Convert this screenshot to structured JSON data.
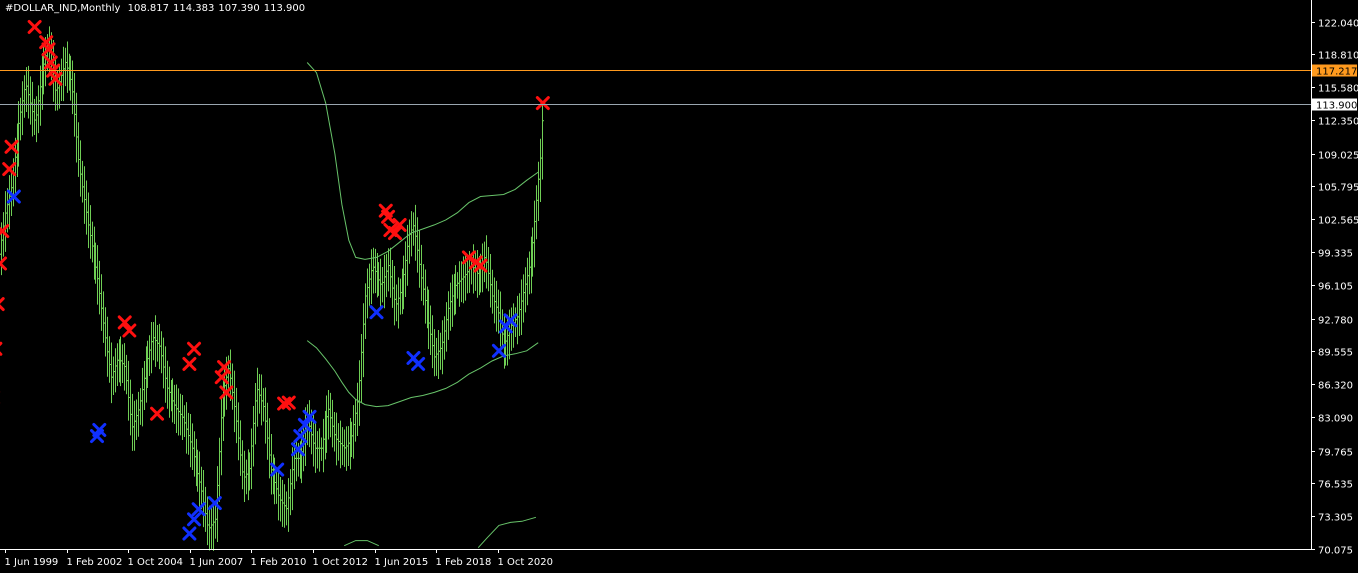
{
  "header": {
    "symbol": "#DOLLAR_IND,Monthly",
    "open": "108.817",
    "high": "114.383",
    "low": "107.390",
    "close": "113.900"
  },
  "colors": {
    "background": "#000000",
    "bars": "#6fce55",
    "band": "#68c46a",
    "sell_marker": "#ff1010",
    "buy_marker": "#1030ff",
    "level_line": "#ff9a1e",
    "price_line": "#9aa6b0",
    "axis": "#ffffff"
  },
  "horizontal_lines": [
    {
      "name": "level-line",
      "value": 117.217,
      "label": "117.217"
    },
    {
      "name": "price-line",
      "value": 113.9,
      "label": "113.900"
    }
  ],
  "chart_data": {
    "type": "bar",
    "symbol": "#DOLLAR_IND",
    "timeframe": "Monthly",
    "ylim": [
      70.075,
      122.04
    ],
    "y_ticks": [
      "122.040",
      "118.810",
      "115.580",
      "112.350",
      "109.025",
      "105.795",
      "102.565",
      "99.335",
      "96.105",
      "92.780",
      "89.555",
      "86.320",
      "83.090",
      "79.765",
      "76.535",
      "73.305",
      "70.075"
    ],
    "x_ticks": [
      "1 Jun 1999",
      "1 Feb 2002",
      "1 Oct 2004",
      "1 Jun 2007",
      "1 Feb 2010",
      "1 Oct 2012",
      "1 Jun 2015",
      "1 Feb 2018",
      "1 Oct 2020"
    ],
    "bar_start": "1998-10",
    "close_path": [
      [
        1998.8,
        104.5
      ],
      [
        1999.1,
        98
      ],
      [
        1999.4,
        103
      ],
      [
        1999.7,
        106
      ],
      [
        2000.0,
        112
      ],
      [
        2000.3,
        116
      ],
      [
        2000.7,
        112
      ],
      [
        2001.0,
        117
      ],
      [
        2001.3,
        120
      ],
      [
        2001.6,
        115
      ],
      [
        2002.0,
        118
      ],
      [
        2002.3,
        116
      ],
      [
        2002.6,
        108
      ],
      [
        2003.0,
        102
      ],
      [
        2003.4,
        97
      ],
      [
        2003.8,
        90
      ],
      [
        2004.0,
        87
      ],
      [
        2004.3,
        89
      ],
      [
        2004.6,
        88
      ],
      [
        2004.9,
        82
      ],
      [
        2005.2,
        84
      ],
      [
        2005.5,
        88
      ],
      [
        2005.8,
        91
      ],
      [
        2006.1,
        90
      ],
      [
        2006.4,
        86
      ],
      [
        2006.8,
        84
      ],
      [
        2007.1,
        83
      ],
      [
        2007.5,
        80
      ],
      [
        2007.9,
        76
      ],
      [
        2008.2,
        72
      ],
      [
        2008.5,
        73
      ],
      [
        2008.8,
        85
      ],
      [
        2009.1,
        88
      ],
      [
        2009.4,
        83
      ],
      [
        2009.7,
        77
      ],
      [
        2010.0,
        78
      ],
      [
        2010.3,
        86
      ],
      [
        2010.6,
        84
      ],
      [
        2010.9,
        78
      ],
      [
        2011.3,
        75
      ],
      [
        2011.6,
        74
      ],
      [
        2011.9,
        79
      ],
      [
        2012.2,
        79
      ],
      [
        2012.5,
        83
      ],
      [
        2012.8,
        80
      ],
      [
        2013.1,
        80
      ],
      [
        2013.4,
        84
      ],
      [
        2013.7,
        81
      ],
      [
        2014.1,
        80
      ],
      [
        2014.4,
        81
      ],
      [
        2014.7,
        85
      ],
      [
        2015.0,
        95
      ],
      [
        2015.3,
        98
      ],
      [
        2015.7,
        96
      ],
      [
        2016.0,
        98
      ],
      [
        2016.3,
        94
      ],
      [
        2016.6,
        96
      ],
      [
        2016.9,
        101
      ],
      [
        2017.1,
        102
      ],
      [
        2017.4,
        97
      ],
      [
        2017.7,
        93
      ],
      [
        2018.0,
        89
      ],
      [
        2018.3,
        90
      ],
      [
        2018.6,
        94
      ],
      [
        2018.9,
        96
      ],
      [
        2019.3,
        97
      ],
      [
        2019.6,
        98
      ],
      [
        2019.9,
        97
      ],
      [
        2020.2,
        99
      ],
      [
        2020.5,
        95
      ],
      [
        2020.8,
        93
      ],
      [
        2021.0,
        90
      ],
      [
        2021.3,
        92
      ],
      [
        2021.6,
        93
      ],
      [
        2021.9,
        96
      ],
      [
        2022.2,
        99
      ],
      [
        2022.4,
        104
      ],
      [
        2022.6,
        109
      ],
      [
        2022.7,
        113.9
      ]
    ],
    "upper_band": [
      [
        2012.5,
        118
      ],
      [
        2012.9,
        117
      ],
      [
        2013.3,
        114
      ],
      [
        2013.7,
        109
      ],
      [
        2014.0,
        104
      ],
      [
        2014.3,
        100.5
      ],
      [
        2014.6,
        98.8
      ],
      [
        2015.0,
        98.6
      ],
      [
        2015.5,
        98.8
      ],
      [
        2016.0,
        99.4
      ],
      [
        2016.5,
        100.3
      ],
      [
        2017.0,
        101.2
      ],
      [
        2017.5,
        101.6
      ],
      [
        2018.0,
        102.0
      ],
      [
        2018.5,
        102.5
      ],
      [
        2019.0,
        103.2
      ],
      [
        2019.5,
        104.2
      ],
      [
        2020.0,
        104.8
      ],
      [
        2020.5,
        104.9
      ],
      [
        2021.0,
        105.0
      ],
      [
        2021.5,
        105.5
      ],
      [
        2022.0,
        106.4
      ],
      [
        2022.5,
        107.2
      ]
    ],
    "lower_band": [
      [
        2012.5,
        90.6
      ],
      [
        2012.9,
        89.9
      ],
      [
        2013.3,
        88.8
      ],
      [
        2013.7,
        87.6
      ],
      [
        2014.0,
        86.5
      ],
      [
        2014.3,
        85.5
      ],
      [
        2014.6,
        84.8
      ],
      [
        2015.0,
        84.3
      ],
      [
        2015.5,
        84.1
      ],
      [
        2016.0,
        84.2
      ],
      [
        2016.5,
        84.6
      ],
      [
        2017.0,
        85.0
      ],
      [
        2017.5,
        85.2
      ],
      [
        2018.0,
        85.5
      ],
      [
        2018.5,
        85.9
      ],
      [
        2019.0,
        86.5
      ],
      [
        2019.5,
        87.3
      ],
      [
        2020.0,
        87.9
      ],
      [
        2020.5,
        88.6
      ],
      [
        2021.0,
        89.1
      ],
      [
        2021.5,
        89.3
      ],
      [
        2022.0,
        89.6
      ],
      [
        2022.5,
        90.4
      ]
    ],
    "bottom_band_segments": [
      [
        [
          2014.1,
          70.4
        ],
        [
          2014.6,
          70.9
        ],
        [
          2015.1,
          70.9
        ],
        [
          2015.6,
          70.4
        ]
      ],
      [
        [
          2019.9,
          70.2
        ],
        [
          2020.3,
          71.2
        ],
        [
          2020.8,
          72.4
        ],
        [
          2021.3,
          72.7
        ],
        [
          2021.8,
          72.8
        ],
        [
          2022.4,
          73.2
        ]
      ]
    ],
    "sell_markers": [
      [
        1998.7,
        74.6
      ],
      [
        1998.8,
        80
      ],
      [
        1998.9,
        85
      ],
      [
        1999.0,
        89.8
      ],
      [
        1999.1,
        94.2
      ],
      [
        1999.2,
        98.2
      ],
      [
        1999.3,
        101.4
      ],
      [
        1999.6,
        107.5
      ],
      [
        1999.7,
        109.7
      ],
      [
        2000.7,
        121.5
      ],
      [
        2001.2,
        120
      ],
      [
        2001.3,
        119.3
      ],
      [
        2001.4,
        118
      ],
      [
        2001.5,
        117.2
      ],
      [
        2001.6,
        116.4
      ],
      [
        2004.6,
        92.4
      ],
      [
        2004.8,
        91.6
      ],
      [
        2006.0,
        83.4
      ],
      [
        2007.4,
        88.3
      ],
      [
        2007.6,
        89.8
      ],
      [
        2008.8,
        87
      ],
      [
        2008.9,
        88
      ],
      [
        2009.0,
        85.5
      ],
      [
        2011.5,
        84.4
      ],
      [
        2011.7,
        84.5
      ],
      [
        2015.9,
        103.4
      ],
      [
        2016.0,
        102.8
      ],
      [
        2016.1,
        101.5
      ],
      [
        2016.3,
        101.2
      ],
      [
        2016.5,
        102.0
      ],
      [
        2019.5,
        98.8
      ],
      [
        2019.8,
        98.3
      ],
      [
        2020.0,
        98.0
      ],
      [
        2022.7,
        114
      ]
    ],
    "buy_markers": [
      [
        1999.8,
        104.8
      ],
      [
        2003.4,
        81.2
      ],
      [
        2003.5,
        81.8
      ],
      [
        2007.4,
        71.6
      ],
      [
        2007.6,
        73.0
      ],
      [
        2007.8,
        74.0
      ],
      [
        2008.5,
        74.6
      ],
      [
        2011.2,
        77.9
      ],
      [
        2012.1,
        79.9
      ],
      [
        2012.2,
        81.2
      ],
      [
        2012.4,
        82.3
      ],
      [
        2012.6,
        83.1
      ],
      [
        2015.5,
        93.4
      ],
      [
        2017.1,
        88.9
      ],
      [
        2017.3,
        88.3
      ],
      [
        2020.8,
        89.6
      ],
      [
        2021.1,
        92.0
      ],
      [
        2021.3,
        92.6
      ]
    ]
  }
}
